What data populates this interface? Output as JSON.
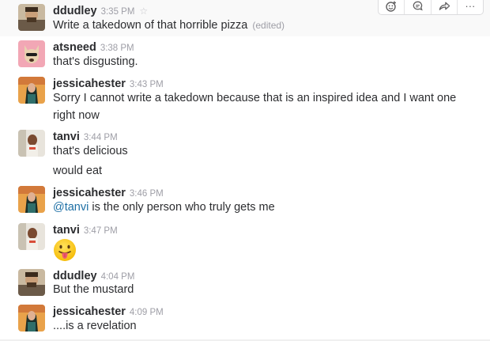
{
  "actions": {
    "reaction_icon": "add-reaction-icon",
    "reply_icon": "reply-thread-icon",
    "share_icon": "share-icon",
    "more_label": "···"
  },
  "messages": [
    {
      "user": "ddudley",
      "time": "3:35 PM",
      "starred": false,
      "lines": [
        "Write a takedown of that horrible pizza"
      ],
      "edited": "(edited)"
    },
    {
      "user": "atsneed",
      "time": "3:38 PM",
      "lines": [
        "that's disgusting."
      ]
    },
    {
      "user": "jessicahester",
      "time": "3:43 PM",
      "lines": [
        "Sorry I cannot write a takedown because that is an inspired idea and I want one",
        "right now"
      ]
    },
    {
      "user": "tanvi",
      "time": "3:44 PM",
      "lines": [
        "that's delicious",
        "would eat"
      ]
    },
    {
      "user": "jessicahester",
      "time": "3:46 PM",
      "mention": "@tanvi",
      "text_after_mention": " is the only person who truly gets me"
    },
    {
      "user": "tanvi",
      "time": "3:47 PM",
      "emoji": "tongue-out-emoji"
    },
    {
      "user": "ddudley",
      "time": "4:04 PM",
      "lines": [
        "But the mustard"
      ]
    },
    {
      "user": "jessicahester",
      "time": "4:09 PM",
      "lines": [
        "....is a revelation"
      ]
    }
  ],
  "colors": {
    "username": "#2c2d30",
    "timestamp": "#9e9ea6",
    "mention": "#1d6fa5",
    "hover_bg": "#f9f9f9"
  }
}
